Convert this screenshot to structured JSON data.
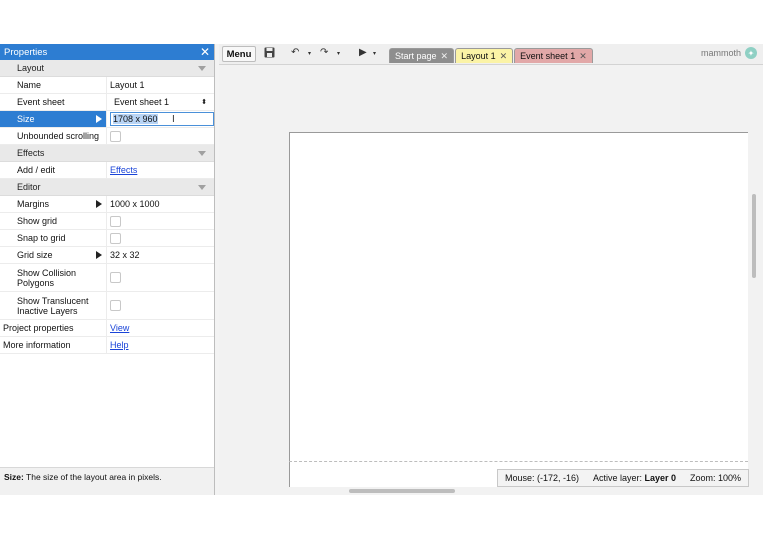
{
  "properties": {
    "title": "Properties",
    "categories": {
      "layout": "Layout",
      "effects": "Effects",
      "editor": "Editor"
    },
    "rows": {
      "name": {
        "label": "Name",
        "value": "Layout 1"
      },
      "event_sheet": {
        "label": "Event sheet",
        "value": "Event sheet 1"
      },
      "size": {
        "label": "Size",
        "value": "1708 x 960"
      },
      "unbounded_scrolling": {
        "label": "Unbounded scrolling",
        "checked": false
      },
      "add_edit": {
        "label": "Add / edit",
        "value": "Effects"
      },
      "margins": {
        "label": "Margins",
        "value": "1000 x 1000"
      },
      "show_grid": {
        "label": "Show grid",
        "checked": false
      },
      "snap_to_grid": {
        "label": "Snap to grid",
        "checked": false
      },
      "grid_size": {
        "label": "Grid size",
        "value": "32 x 32"
      },
      "show_collision": {
        "label_line1": "Show Collision",
        "label_line2": "Polygons",
        "checked": false
      },
      "show_translucent": {
        "label_line1": "Show Translucent",
        "label_line2": "Inactive Layers",
        "checked": false
      },
      "project_properties": {
        "label": "Project properties",
        "value": "View"
      },
      "more_information": {
        "label": "More information",
        "value": "Help"
      }
    },
    "status": {
      "term": "Size:",
      "text": " The size of the layout area in pixels."
    }
  },
  "toolbar": {
    "menu_label": "Menu",
    "icons": [
      "save-icon",
      "undo-icon",
      "redo-icon",
      "play-icon"
    ],
    "tabs": [
      {
        "label": "Start page",
        "color": "#8e8e8e"
      },
      {
        "label": "Layout 1",
        "color": "#fbf3a6"
      },
      {
        "label": "Event sheet 1",
        "color": "#e2a8a8"
      }
    ],
    "brand": "mammoth"
  },
  "statusbar": {
    "mouse": "Mouse: (-172, -16)",
    "active_layer_label": "Active layer: ",
    "active_layer_value": "Layer 0",
    "zoom": "Zoom: 100%"
  },
  "colors": {
    "accent": "#2d7dd2",
    "link": "#1a44d8"
  }
}
